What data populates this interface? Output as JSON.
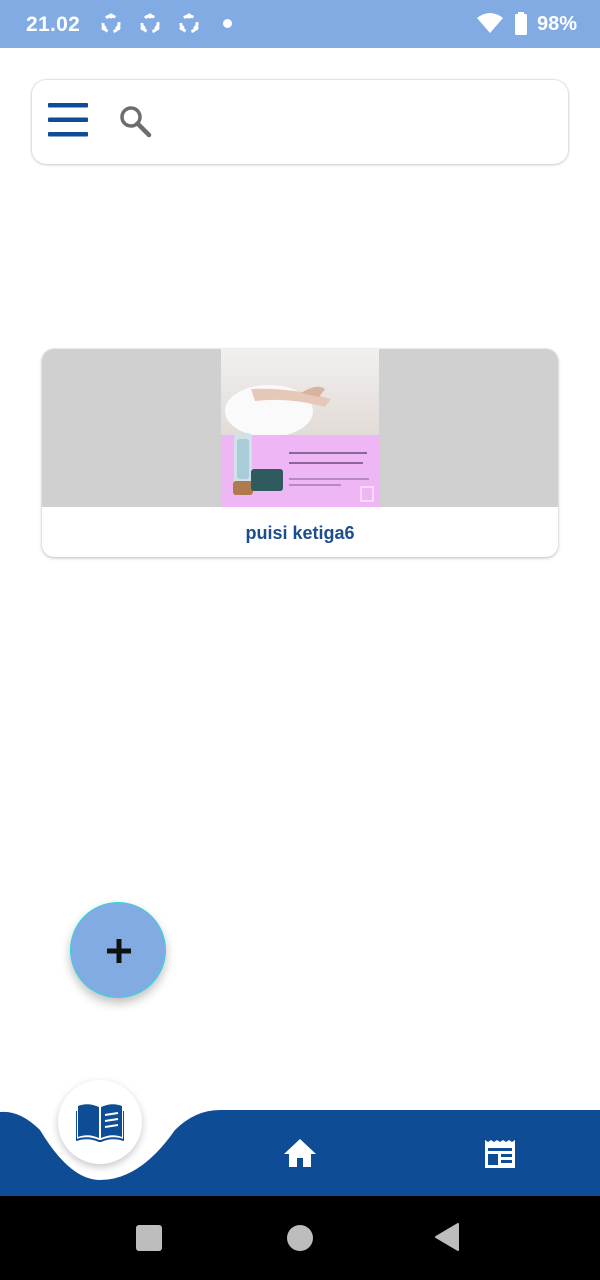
{
  "status_bar": {
    "time": "21.02",
    "battery_percent": "98%",
    "notification_icons": [
      "sync-icon",
      "sync-icon",
      "sync-icon",
      "dot-icon"
    ]
  },
  "search_bar": {
    "menu_icon": "hamburger-menu-icon",
    "search_icon": "search-icon"
  },
  "cards": [
    {
      "title": "puisi ketiga6",
      "thumbnail_text": "Cerahkan kulitmu dengan Bellyana Lotion"
    }
  ],
  "fab": {
    "icon": "plus-icon"
  },
  "bottom_nav": {
    "items": [
      {
        "icon": "book-icon",
        "active": true
      },
      {
        "icon": "home-icon",
        "active": false
      },
      {
        "icon": "newspaper-icon",
        "active": false
      }
    ]
  },
  "colors": {
    "status_bar": "#83abe3",
    "accent_blue": "#0f4c96",
    "title_blue": "#1b4d8f",
    "fab_bg": "#83abe3",
    "card_image_bg": "#d0d0d0"
  }
}
